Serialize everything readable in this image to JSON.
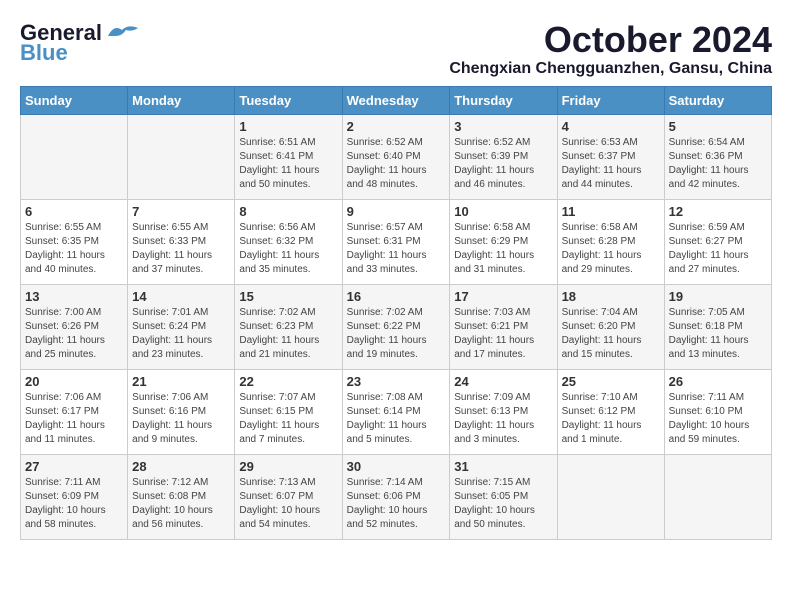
{
  "logo": {
    "general": "General",
    "blue": "Blue"
  },
  "header": {
    "month": "October 2024",
    "location": "Chengxian Chengguanzhen, Gansu, China"
  },
  "weekdays": [
    "Sunday",
    "Monday",
    "Tuesday",
    "Wednesday",
    "Thursday",
    "Friday",
    "Saturday"
  ],
  "weeks": [
    [
      {
        "day": "",
        "sunrise": "",
        "sunset": "",
        "daylight": ""
      },
      {
        "day": "",
        "sunrise": "",
        "sunset": "",
        "daylight": ""
      },
      {
        "day": "1",
        "sunrise": "Sunrise: 6:51 AM",
        "sunset": "Sunset: 6:41 PM",
        "daylight": "Daylight: 11 hours and 50 minutes."
      },
      {
        "day": "2",
        "sunrise": "Sunrise: 6:52 AM",
        "sunset": "Sunset: 6:40 PM",
        "daylight": "Daylight: 11 hours and 48 minutes."
      },
      {
        "day": "3",
        "sunrise": "Sunrise: 6:52 AM",
        "sunset": "Sunset: 6:39 PM",
        "daylight": "Daylight: 11 hours and 46 minutes."
      },
      {
        "day": "4",
        "sunrise": "Sunrise: 6:53 AM",
        "sunset": "Sunset: 6:37 PM",
        "daylight": "Daylight: 11 hours and 44 minutes."
      },
      {
        "day": "5",
        "sunrise": "Sunrise: 6:54 AM",
        "sunset": "Sunset: 6:36 PM",
        "daylight": "Daylight: 11 hours and 42 minutes."
      }
    ],
    [
      {
        "day": "6",
        "sunrise": "Sunrise: 6:55 AM",
        "sunset": "Sunset: 6:35 PM",
        "daylight": "Daylight: 11 hours and 40 minutes."
      },
      {
        "day": "7",
        "sunrise": "Sunrise: 6:55 AM",
        "sunset": "Sunset: 6:33 PM",
        "daylight": "Daylight: 11 hours and 37 minutes."
      },
      {
        "day": "8",
        "sunrise": "Sunrise: 6:56 AM",
        "sunset": "Sunset: 6:32 PM",
        "daylight": "Daylight: 11 hours and 35 minutes."
      },
      {
        "day": "9",
        "sunrise": "Sunrise: 6:57 AM",
        "sunset": "Sunset: 6:31 PM",
        "daylight": "Daylight: 11 hours and 33 minutes."
      },
      {
        "day": "10",
        "sunrise": "Sunrise: 6:58 AM",
        "sunset": "Sunset: 6:29 PM",
        "daylight": "Daylight: 11 hours and 31 minutes."
      },
      {
        "day": "11",
        "sunrise": "Sunrise: 6:58 AM",
        "sunset": "Sunset: 6:28 PM",
        "daylight": "Daylight: 11 hours and 29 minutes."
      },
      {
        "day": "12",
        "sunrise": "Sunrise: 6:59 AM",
        "sunset": "Sunset: 6:27 PM",
        "daylight": "Daylight: 11 hours and 27 minutes."
      }
    ],
    [
      {
        "day": "13",
        "sunrise": "Sunrise: 7:00 AM",
        "sunset": "Sunset: 6:26 PM",
        "daylight": "Daylight: 11 hours and 25 minutes."
      },
      {
        "day": "14",
        "sunrise": "Sunrise: 7:01 AM",
        "sunset": "Sunset: 6:24 PM",
        "daylight": "Daylight: 11 hours and 23 minutes."
      },
      {
        "day": "15",
        "sunrise": "Sunrise: 7:02 AM",
        "sunset": "Sunset: 6:23 PM",
        "daylight": "Daylight: 11 hours and 21 minutes."
      },
      {
        "day": "16",
        "sunrise": "Sunrise: 7:02 AM",
        "sunset": "Sunset: 6:22 PM",
        "daylight": "Daylight: 11 hours and 19 minutes."
      },
      {
        "day": "17",
        "sunrise": "Sunrise: 7:03 AM",
        "sunset": "Sunset: 6:21 PM",
        "daylight": "Daylight: 11 hours and 17 minutes."
      },
      {
        "day": "18",
        "sunrise": "Sunrise: 7:04 AM",
        "sunset": "Sunset: 6:20 PM",
        "daylight": "Daylight: 11 hours and 15 minutes."
      },
      {
        "day": "19",
        "sunrise": "Sunrise: 7:05 AM",
        "sunset": "Sunset: 6:18 PM",
        "daylight": "Daylight: 11 hours and 13 minutes."
      }
    ],
    [
      {
        "day": "20",
        "sunrise": "Sunrise: 7:06 AM",
        "sunset": "Sunset: 6:17 PM",
        "daylight": "Daylight: 11 hours and 11 minutes."
      },
      {
        "day": "21",
        "sunrise": "Sunrise: 7:06 AM",
        "sunset": "Sunset: 6:16 PM",
        "daylight": "Daylight: 11 hours and 9 minutes."
      },
      {
        "day": "22",
        "sunrise": "Sunrise: 7:07 AM",
        "sunset": "Sunset: 6:15 PM",
        "daylight": "Daylight: 11 hours and 7 minutes."
      },
      {
        "day": "23",
        "sunrise": "Sunrise: 7:08 AM",
        "sunset": "Sunset: 6:14 PM",
        "daylight": "Daylight: 11 hours and 5 minutes."
      },
      {
        "day": "24",
        "sunrise": "Sunrise: 7:09 AM",
        "sunset": "Sunset: 6:13 PM",
        "daylight": "Daylight: 11 hours and 3 minutes."
      },
      {
        "day": "25",
        "sunrise": "Sunrise: 7:10 AM",
        "sunset": "Sunset: 6:12 PM",
        "daylight": "Daylight: 11 hours and 1 minute."
      },
      {
        "day": "26",
        "sunrise": "Sunrise: 7:11 AM",
        "sunset": "Sunset: 6:10 PM",
        "daylight": "Daylight: 10 hours and 59 minutes."
      }
    ],
    [
      {
        "day": "27",
        "sunrise": "Sunrise: 7:11 AM",
        "sunset": "Sunset: 6:09 PM",
        "daylight": "Daylight: 10 hours and 58 minutes."
      },
      {
        "day": "28",
        "sunrise": "Sunrise: 7:12 AM",
        "sunset": "Sunset: 6:08 PM",
        "daylight": "Daylight: 10 hours and 56 minutes."
      },
      {
        "day": "29",
        "sunrise": "Sunrise: 7:13 AM",
        "sunset": "Sunset: 6:07 PM",
        "daylight": "Daylight: 10 hours and 54 minutes."
      },
      {
        "day": "30",
        "sunrise": "Sunrise: 7:14 AM",
        "sunset": "Sunset: 6:06 PM",
        "daylight": "Daylight: 10 hours and 52 minutes."
      },
      {
        "day": "31",
        "sunrise": "Sunrise: 7:15 AM",
        "sunset": "Sunset: 6:05 PM",
        "daylight": "Daylight: 10 hours and 50 minutes."
      },
      {
        "day": "",
        "sunrise": "",
        "sunset": "",
        "daylight": ""
      },
      {
        "day": "",
        "sunrise": "",
        "sunset": "",
        "daylight": ""
      }
    ]
  ]
}
